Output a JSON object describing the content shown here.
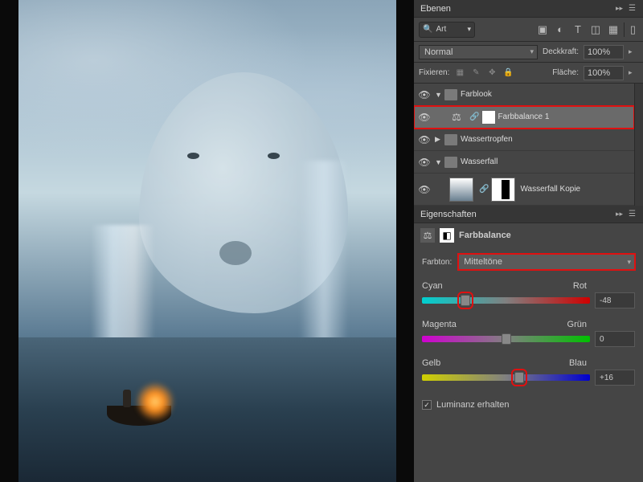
{
  "panels": {
    "layers_title": "Ebenen",
    "filter_label": "Art",
    "blend_mode": "Normal",
    "opacity_label": "Deckkraft:",
    "opacity_value": "100%",
    "lock_label": "Fixieren:",
    "fill_label": "Fläche:",
    "fill_value": "100%"
  },
  "layers": [
    {
      "type": "group",
      "name": "Farblook",
      "open": true,
      "depth": 0
    },
    {
      "type": "adj",
      "name": "Farbbalance 1",
      "depth": 1,
      "selected": true,
      "highlight": true
    },
    {
      "type": "group",
      "name": "Wassertropfen",
      "open": false,
      "depth": 0
    },
    {
      "type": "group",
      "name": "Wasserfall",
      "open": true,
      "depth": 0
    },
    {
      "type": "layer",
      "name": "Wasserfall Kopie",
      "depth": 1
    }
  ],
  "properties": {
    "panel_title": "Eigenschaften",
    "adj_title": "Farbbalance",
    "tone_label": "Farbton:",
    "tone_value": "Mitteltöne",
    "sliders": [
      {
        "left": "Cyan",
        "right": "Rot",
        "value": "-48",
        "pos": 26,
        "grad": "grad-cr",
        "hl": true
      },
      {
        "left": "Magenta",
        "right": "Grün",
        "value": "0",
        "pos": 50,
        "grad": "grad-mg",
        "hl": false
      },
      {
        "left": "Gelb",
        "right": "Blau",
        "value": "+16",
        "pos": 58,
        "grad": "grad-yb",
        "hl": true
      }
    ],
    "luminance_label": "Luminanz erhalten",
    "luminance_checked": true
  }
}
